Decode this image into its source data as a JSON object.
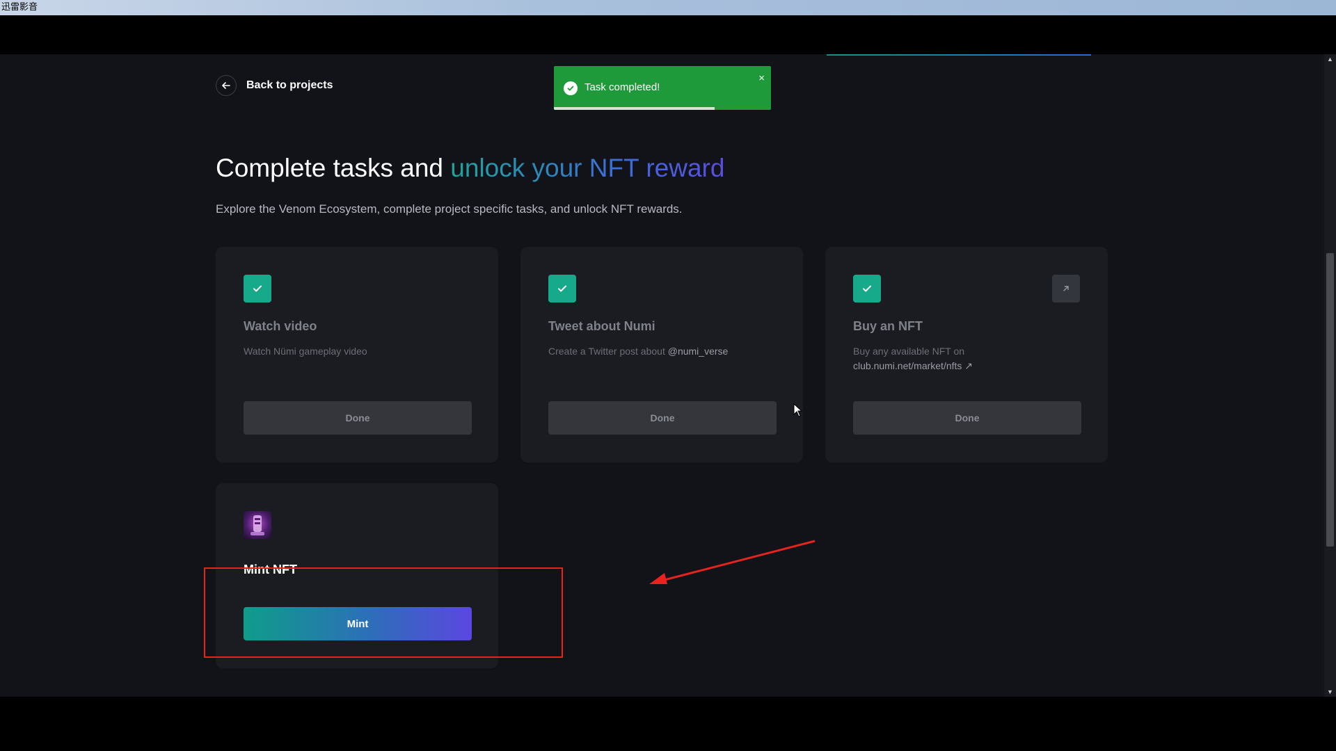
{
  "window": {
    "title": "迅雷影音"
  },
  "nav": {
    "back_label": "Back to projects"
  },
  "toast": {
    "message": "Task completed!",
    "close_glyph": "×",
    "progress": 0.74
  },
  "hero": {
    "title_plain": "Complete tasks and ",
    "title_highlight": "unlock your NFT reward",
    "subtitle": "Explore the Venom Ecosystem, complete project specific tasks, and unlock NFT rewards."
  },
  "tasks": [
    {
      "title": "Watch video",
      "description": "Watch Nümi gameplay video",
      "button_label": "Done",
      "status": "completed",
      "icon": "check-icon"
    },
    {
      "title": "Tweet about Numi",
      "description_prefix": "Create a Twitter post about ",
      "description_highlight": "@numi_verse",
      "button_label": "Done",
      "status": "completed",
      "icon": "check-icon"
    },
    {
      "title": "Buy an NFT",
      "description_prefix": "Buy any available NFT on ",
      "description_link": "club.numi.net/market/nfts ↗",
      "button_label": "Done",
      "status": "completed",
      "icon": "check-icon",
      "external_icon": "external-link-icon"
    }
  ],
  "mint": {
    "title": "Mint NFT",
    "button_label": "Mint",
    "thumbnail": "nft-avatar"
  },
  "colors": {
    "accent_green": "#16a98a",
    "toast_green": "#1f9a3a",
    "gradient_start": "#0f9c8a",
    "gradient_end": "#5a47e0",
    "annotation_red": "#e8221d"
  }
}
